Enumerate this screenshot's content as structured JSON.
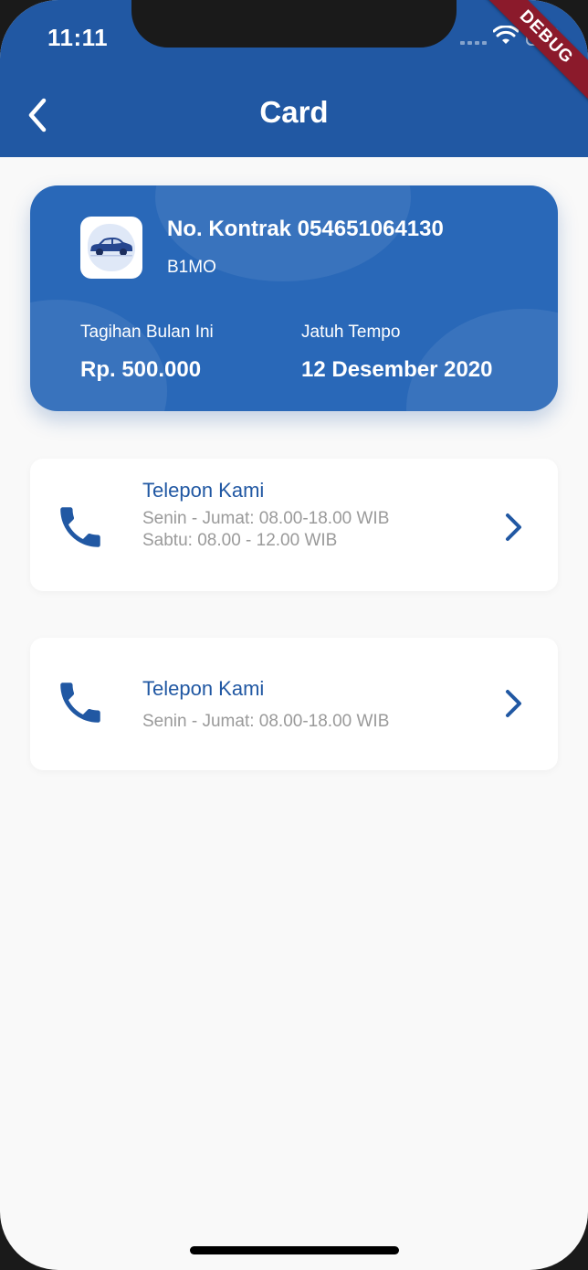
{
  "status_bar": {
    "time": "11:11"
  },
  "debug_banner": "DEBUG",
  "app_bar": {
    "title": "Card",
    "back_icon": "chevron-left-icon"
  },
  "contract_card": {
    "contract_number": "No. Kontrak 054651064130",
    "product_code": "B1MO",
    "logo_icon": "car-icon",
    "bill_label": "Tagihan Bulan Ini",
    "bill_value": "Rp. 500.000",
    "due_label": "Jatuh Tempo",
    "due_value": "12 Desember 2020"
  },
  "contacts": [
    {
      "title": "Telepon Kami",
      "lines": [
        "Senin - Jumat: 08.00-18.00 WIB",
        "Sabtu: 08.00 - 12.00 WIB"
      ],
      "icon": "phone-icon"
    },
    {
      "title": "Telepon Kami",
      "lines": [
        "Senin - Jumat: 08.00-18.00 WIB"
      ],
      "icon": "phone-icon"
    }
  ],
  "colors": {
    "primary": "#2158a3",
    "card": "#2968b8",
    "background": "#f9f9f9",
    "secondary_text": "#9a9a9a"
  }
}
